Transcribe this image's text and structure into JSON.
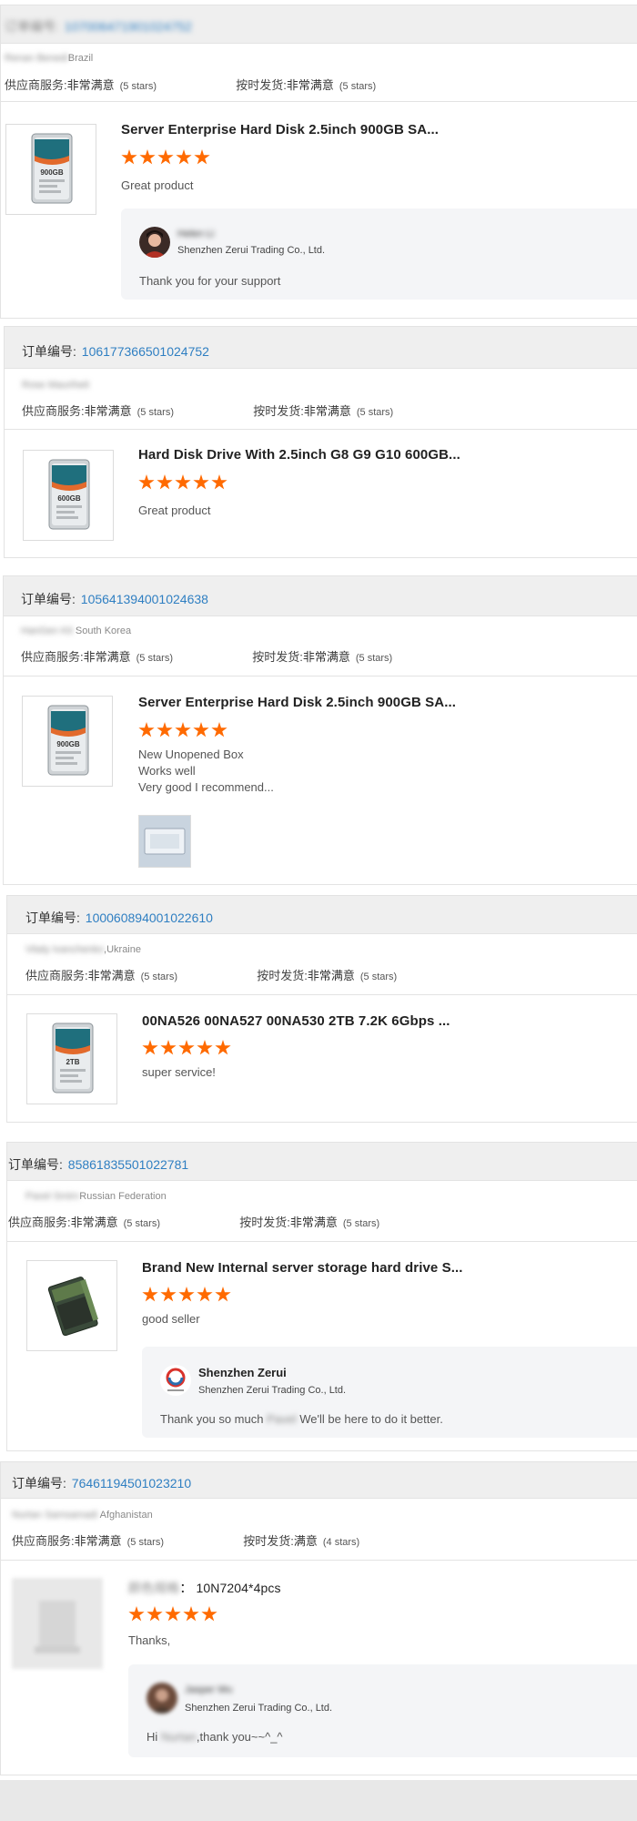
{
  "labels": {
    "order_prefix": "订单编号:",
    "supplier_service": "供应商服务:",
    "on_time_delivery": "按时发货:"
  },
  "reviews": [
    {
      "order_number": "107006471901024752",
      "buyer": "Renan Benedi",
      "country": "Brazil",
      "supplier_rating_text": "非常满意",
      "supplier_rating_stars": "(5 stars)",
      "delivery_rating_text": "非常满意",
      "delivery_rating_stars": "(5 stars)",
      "product_title": "Server Enterprise Hard Disk 2.5inch 900GB SA...",
      "product_image_label": "900GB",
      "stars": 5,
      "comment_lines": [
        "Great product"
      ],
      "reply": {
        "seller": "Helen Li",
        "company": "Shenzhen Zerui Trading Co., Ltd.",
        "text": "Thank you for your support"
      }
    },
    {
      "order_number": "106177366501024752",
      "buyer": "Rose Mauriheit",
      "country": "",
      "supplier_rating_text": "非常满意",
      "supplier_rating_stars": "(5 stars)",
      "delivery_rating_text": "非常满意",
      "delivery_rating_stars": "(5 stars)",
      "product_title": "Hard Disk Drive With 2.5inch G8 G9 G10 600GB...",
      "product_image_label": "600GB",
      "stars": 5,
      "comment_lines": [
        "Great product"
      ]
    },
    {
      "order_number": "105641394001024638",
      "buyer": "HanGen Kit ",
      "country": "South Korea",
      "supplier_rating_text": "非常满意",
      "supplier_rating_stars": "(5 stars)",
      "delivery_rating_text": "非常满意",
      "delivery_rating_stars": "(5 stars)",
      "product_title": "Server Enterprise Hard Disk 2.5inch 900GB SA...",
      "product_image_label": "900GB",
      "stars": 5,
      "comment_lines": [
        "New Unopened Box",
        "Works well",
        "Very good I recommend..."
      ]
    },
    {
      "order_number": "100060894001022610",
      "buyer": "Vitaly Ivanchenko",
      "country": ",Ukraine",
      "supplier_rating_text": "非常满意",
      "supplier_rating_stars": "(5 stars)",
      "delivery_rating_text": "非常满意",
      "delivery_rating_stars": "(5 stars)",
      "product_title": "00NA526 00NA527 00NA530 2TB 7.2K 6Gbps ...",
      "product_image_label": "2TB",
      "stars": 5,
      "comment_lines": [
        "super service!"
      ]
    },
    {
      "order_number": "85861835501022781",
      "buyer": "Pavel Smirn",
      "country": "Russian Federation",
      "supplier_rating_text": "非常满意",
      "supplier_rating_stars": "(5 stars)",
      "delivery_rating_text": "非常满意",
      "delivery_rating_stars": "(5 stars)",
      "product_title": "Brand New Internal server storage hard drive S...",
      "stars": 5,
      "comment_lines": [
        "good seller"
      ],
      "reply": {
        "seller": "Shenzhen Zerui",
        "company": "Shenzhen Zerui Trading Co., Ltd.",
        "text_before": "Thank you so much",
        "text_blur": " Pavel ",
        "text_after": "We'll be here to do it better."
      }
    },
    {
      "order_number": "76461194501023210",
      "buyer": "Nurtan Samsamadi ",
      "country": "Afghanistan",
      "supplier_rating_text": "非常满意",
      "supplier_rating_stars": "(5 stars)",
      "delivery_rating_text": "满意",
      "delivery_rating_stars": "(4 stars)",
      "product_title_blur": "颜色规格",
      "product_title": "： 10N7204*4pcs",
      "stars": 5,
      "comment_lines": [
        "Thanks,"
      ],
      "reply": {
        "seller": "Jasper Wu",
        "company": "Shenzhen Zerui Trading Co., Ltd.",
        "text_before": "Hi ",
        "text_blur": "Nurtan",
        "text_after": ",thank you~~^_^"
      }
    }
  ]
}
